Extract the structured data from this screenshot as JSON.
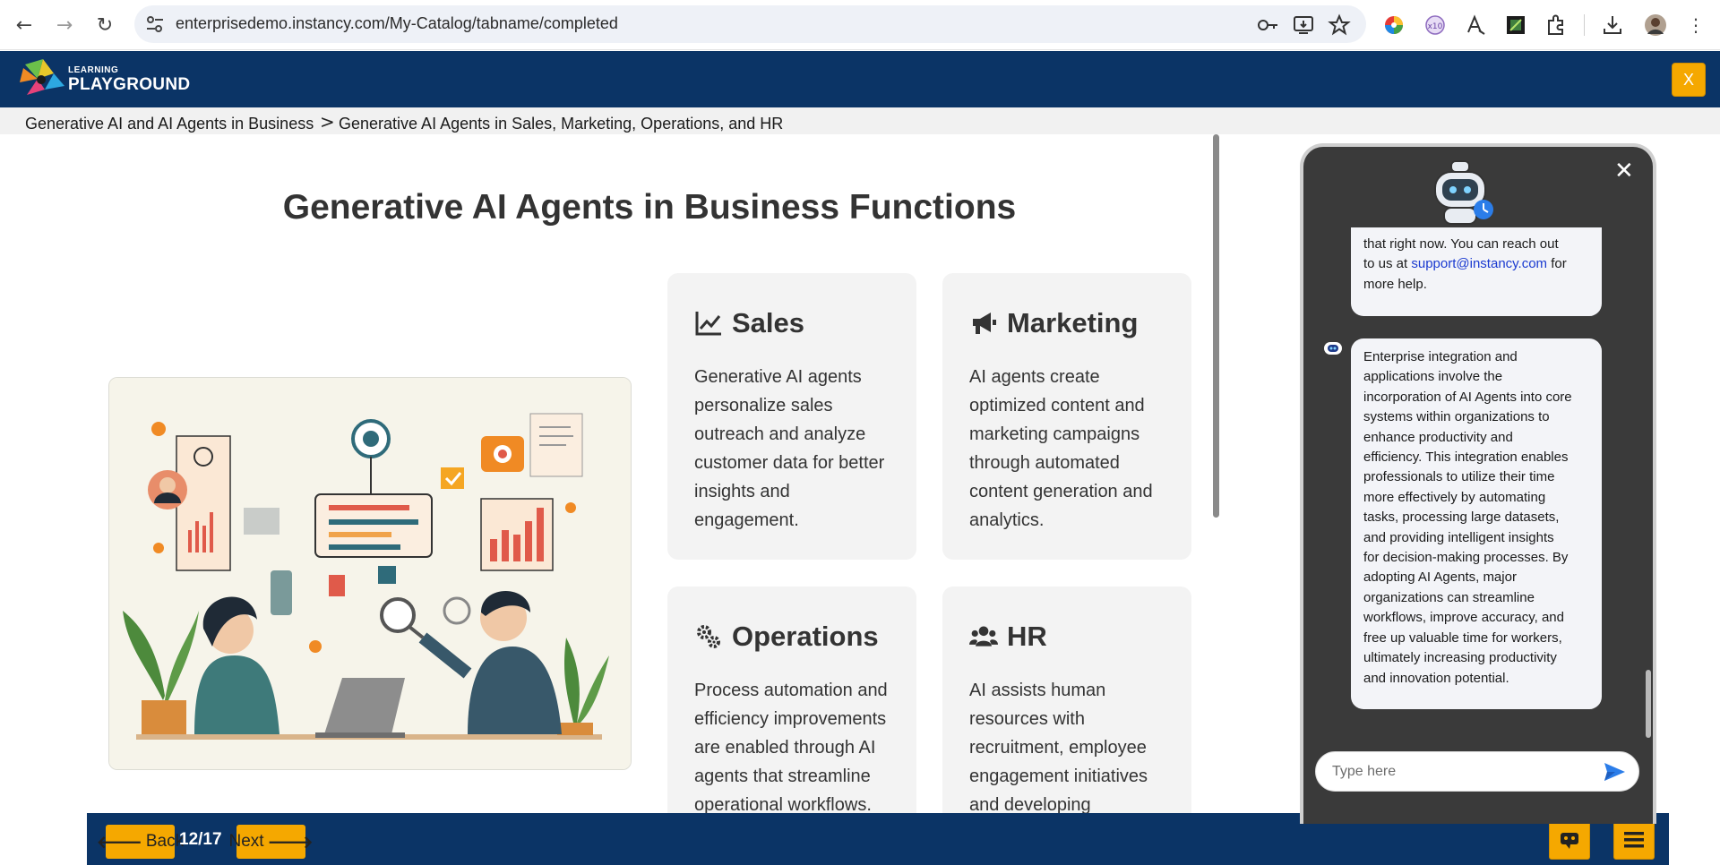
{
  "browser": {
    "url": "enterprisedemo.instancy.com/My-Catalog/tabname/completed"
  },
  "header": {
    "logo_small": "LEARNING",
    "logo_big": "PLAYGROUND",
    "close_label": "X"
  },
  "breadcrumb": {
    "parent": "Generative AI and AI Agents in Business",
    "separator": ">",
    "current": "Generative AI Agents in Sales, Marketing, Operations, and HR"
  },
  "main": {
    "title": "Generative AI Agents in Business Functions",
    "cards": [
      {
        "title": "Sales",
        "icon": "line-chart-icon",
        "lines": [
          "Generative AI agents",
          "personalize sales",
          "outreach and analyze",
          "customer data for better",
          "insights and",
          "engagement."
        ]
      },
      {
        "title": "Marketing",
        "icon": "megaphone-icon",
        "lines": [
          "AI agents create",
          "optimized content and",
          "marketing campaigns",
          "through automated",
          "content generation and",
          "analytics."
        ]
      },
      {
        "title": "Operations",
        "icon": "gears-icon",
        "lines": [
          "Process automation and",
          "efficiency improvements",
          "are enabled through AI",
          "agents that streamline",
          "operational workflows."
        ]
      },
      {
        "title": "HR",
        "icon": "users-icon",
        "lines": [
          "AI assists human",
          "resources with",
          "recruitment, employee",
          "engagement initiatives",
          "and developing"
        ]
      }
    ]
  },
  "chat": {
    "message1_lines": [
      "that right now. You can reach out"
    ],
    "message1_prefix": "to us at ",
    "message1_link": "support@instancy.com",
    "message1_suffix": " for",
    "message1_end": "more help.",
    "message2_lines": [
      "Enterprise integration and",
      "applications involve the",
      "incorporation of AI Agents into core",
      "systems within organizations to",
      "enhance productivity and",
      "efficiency. This integration enables",
      "professionals to utilize their time",
      "more effectively by automating",
      "tasks, processing large datasets,",
      "and providing intelligent insights",
      "for decision-making processes. By",
      "adopting AI Agents, major",
      "organizations can streamline",
      "workflows, improve accuracy, and",
      "free up valuable time for workers,",
      "ultimately increasing productivity",
      "and innovation potential."
    ],
    "input_placeholder": "Type here"
  },
  "footer": {
    "back_label": "Back",
    "next_label": "Next",
    "page_indicator": "12/17"
  },
  "colors": {
    "navy": "#0b3466",
    "accent_orange": "#f5a800",
    "card_bg": "#f3f3f3",
    "chat_bg": "#3a3a3a"
  }
}
